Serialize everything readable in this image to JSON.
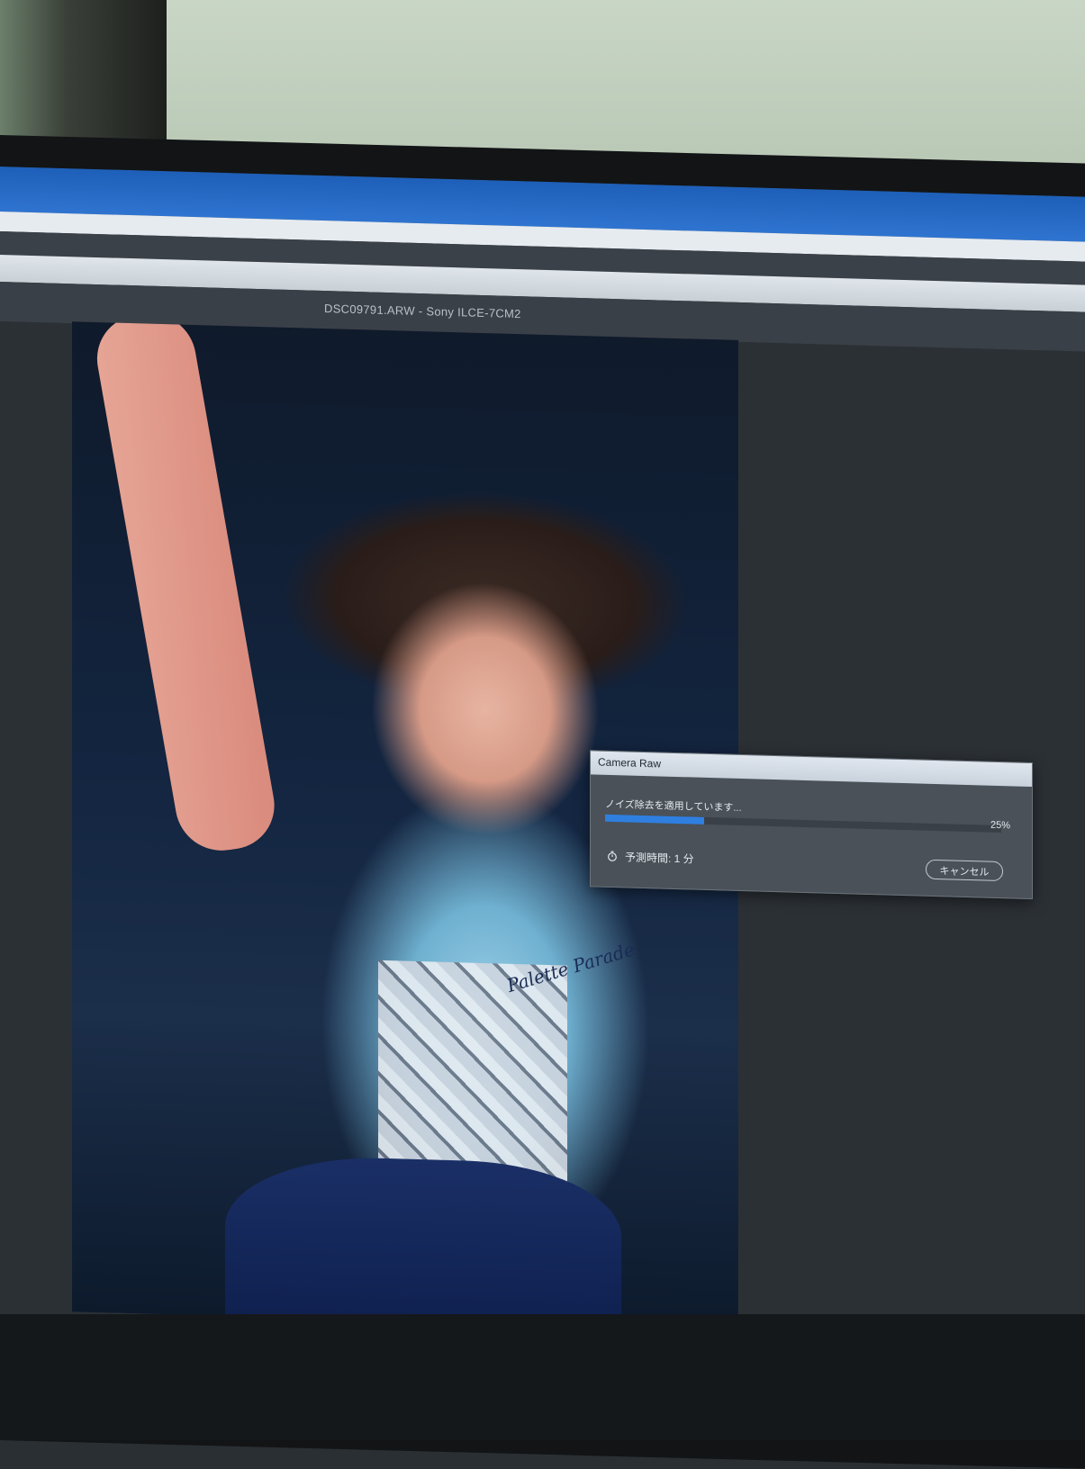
{
  "window": {
    "title": "DSC09791.ARW - Sony ILCE-7CM2"
  },
  "dialog": {
    "title": "Camera Raw",
    "status": "ノイズ除去を適用しています...",
    "progress_percent": 25,
    "progress_label": "25%",
    "eta": "予測時間: 1 分",
    "cancel_label": "キャンセル"
  },
  "photo": {
    "printed_text": "Palette Parade"
  },
  "colors": {
    "accent": "#2f7fe0",
    "titlebar_blue": "#1d5fb8",
    "dialog_bg": "#4a5158"
  },
  "icons": {
    "timer": "stopwatch-icon"
  }
}
